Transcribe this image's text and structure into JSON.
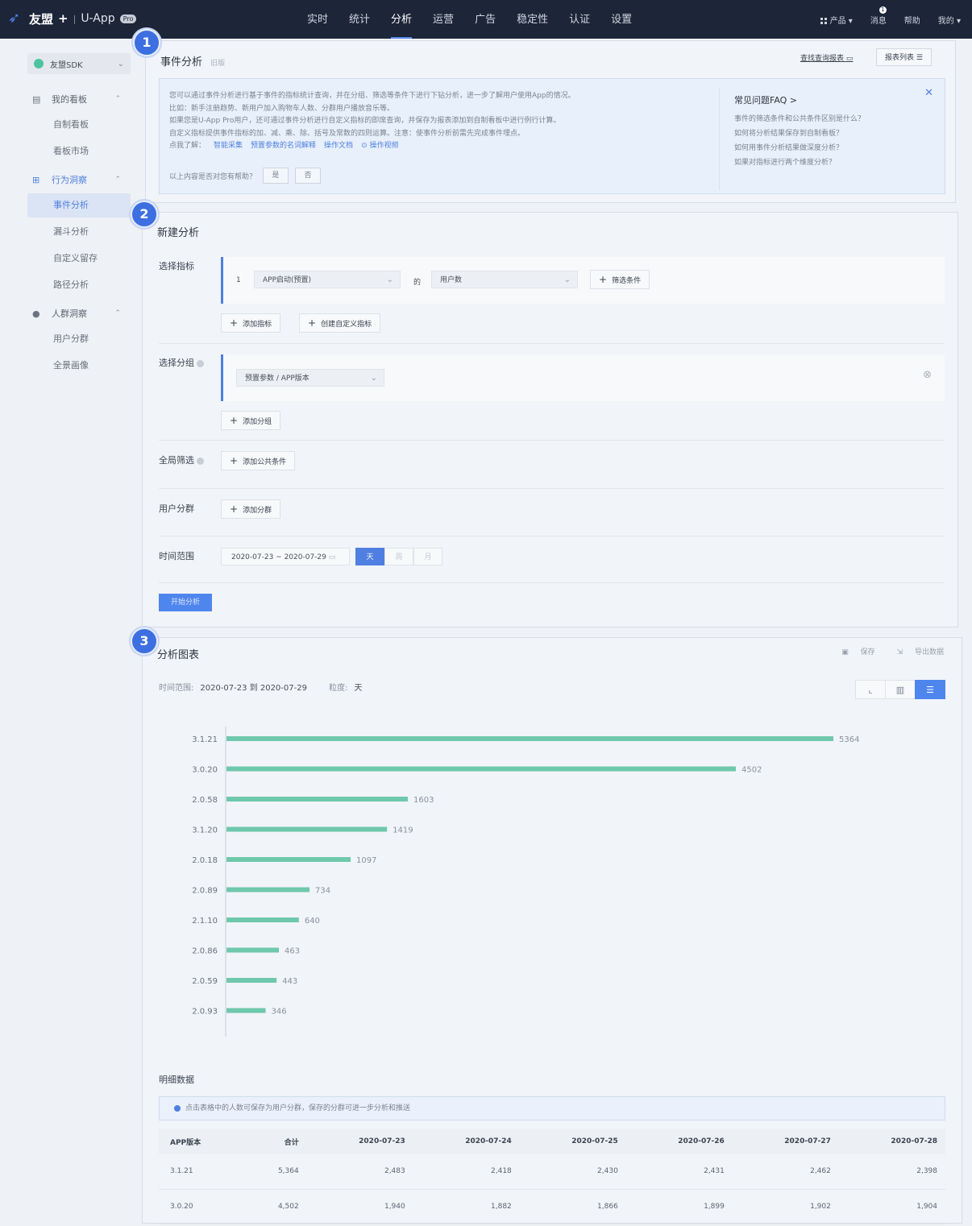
{
  "topbar": {
    "brand": "友盟",
    "brand_plus": "+",
    "app": "U-App",
    "pro": "Pro",
    "nav": [
      "实时",
      "统计",
      "分析",
      "运营",
      "广告",
      "稳定性",
      "认证",
      "设置"
    ],
    "active_nav": 2,
    "product": "产品 ▾",
    "message": "消息",
    "message_badge": "1",
    "help": "帮助",
    "mine": "我的 ▾"
  },
  "sidebar": {
    "sdk": "友盟SDK",
    "groups": {
      "dashboard": "我的看板",
      "behavior": "行为洞察",
      "crowd": "人群洞察"
    },
    "items": {
      "custom_board": "自制看板",
      "board_market": "看板市场",
      "event_analysis": "事件分析",
      "funnel": "漏斗分析",
      "retention": "自定义留存",
      "path": "路径分析",
      "user_group": "用户分群",
      "portrait": "全景画像"
    }
  },
  "steps": [
    "1",
    "2",
    "3"
  ],
  "panel1": {
    "title": "事件分析",
    "title_tag": "旧版",
    "link_saved": "查找查询报表",
    "link_list": "报表列表",
    "help_lines": [
      "您可以通过事件分析进行基于事件的指标统计查询，并在分组、筛选等条件下进行下钻分析，进一步了解用户使用App的情况。",
      "比如：新手注册趋势、新用户加入购物车人数、分群用户播放音乐等。",
      "如果您是U-App Pro用户，还可通过事件分析进行自定义指标的即席查询，并保存为报表添加到自制看板中进行例行计算。",
      "自定义指标提供事件指标的加、减、乘、除、括号及常数的四则运算。注意：使事件分析前需先完成事件埋点。"
    ],
    "learn_prefix": "点我了解：",
    "learn_links": [
      "智能采集",
      "预置参数的名词解释",
      "操作文档",
      "⊙ 操作视频"
    ],
    "feedback_q": "以上内容是否对您有帮助？",
    "yes": "是",
    "no": "否",
    "faq_title": "常见问题FAQ >",
    "faq": [
      "事件的筛选条件和公共条件区别是什么？",
      "如何将分析结果保存到自制看板？",
      "如何用事件分析结果做深度分析？",
      "如果对指标进行两个维度分析？"
    ]
  },
  "panel2": {
    "title": "新建分析",
    "metric_label": "选择指标",
    "metric_index": "1",
    "metric_event": "APP启动(预置)",
    "metric_of": "的",
    "metric_measure": "用户数",
    "filter_btn": "筛选条件",
    "add_metric": "添加指标",
    "create_metric": "创建自定义指标",
    "group_label": "选择分组",
    "group_value": "预置参数 / APP版本",
    "add_group": "添加分组",
    "global_label": "全局筛选",
    "add_public": "添加公共条件",
    "segment_label": "用户分群",
    "add_segment": "添加分群",
    "time_label": "时间范围",
    "date_range": "2020-07-23  ~  2020-07-29",
    "granularity": [
      "天",
      "周",
      "月"
    ],
    "start_btn": "开始分析"
  },
  "panel3": {
    "title": "分析图表",
    "save": "保存",
    "export": "导出数据",
    "range_label": "时间范围:",
    "range_value": "2020-07-23 到 2020-07-29",
    "gran_label": "粒度:",
    "gran_value": "天",
    "chart_icons": [
      "line-chart-icon",
      "bar-chart-icon",
      "horizontal-bar-icon"
    ],
    "detail_title": "明细数据",
    "notice": "点击表格中的人数可保存为用户分群，保存的分群可进一步分析和推送",
    "table": {
      "headers": [
        "APP版本",
        "合计",
        "2020-07-23",
        "2020-07-24",
        "2020-07-25",
        "2020-07-26",
        "2020-07-27",
        "2020-07-28"
      ],
      "rows": [
        [
          "3.1.21",
          "5,364",
          "2,483",
          "2,418",
          "2,430",
          "2,431",
          "2,462",
          "2,398"
        ],
        [
          "3.0.20",
          "4,502",
          "1,940",
          "1,882",
          "1,866",
          "1,899",
          "1,902",
          "1,904"
        ]
      ]
    }
  },
  "colors": {
    "bar": "#6fc8ac",
    "accent": "#4f86ee",
    "nav_bg": "#1d2538"
  },
  "chart_data": {
    "type": "bar",
    "orientation": "horizontal",
    "categories": [
      "3.1.21",
      "3.0.20",
      "2.0.58",
      "3.1.20",
      "2.0.18",
      "2.0.89",
      "2.1.10",
      "2.0.86",
      "2.0.59",
      "2.0.93"
    ],
    "values": [
      5364,
      4502,
      1603,
      1419,
      1097,
      734,
      640,
      463,
      443,
      346
    ],
    "data_labels": true,
    "title": "",
    "xlabel": "",
    "ylabel": ""
  }
}
